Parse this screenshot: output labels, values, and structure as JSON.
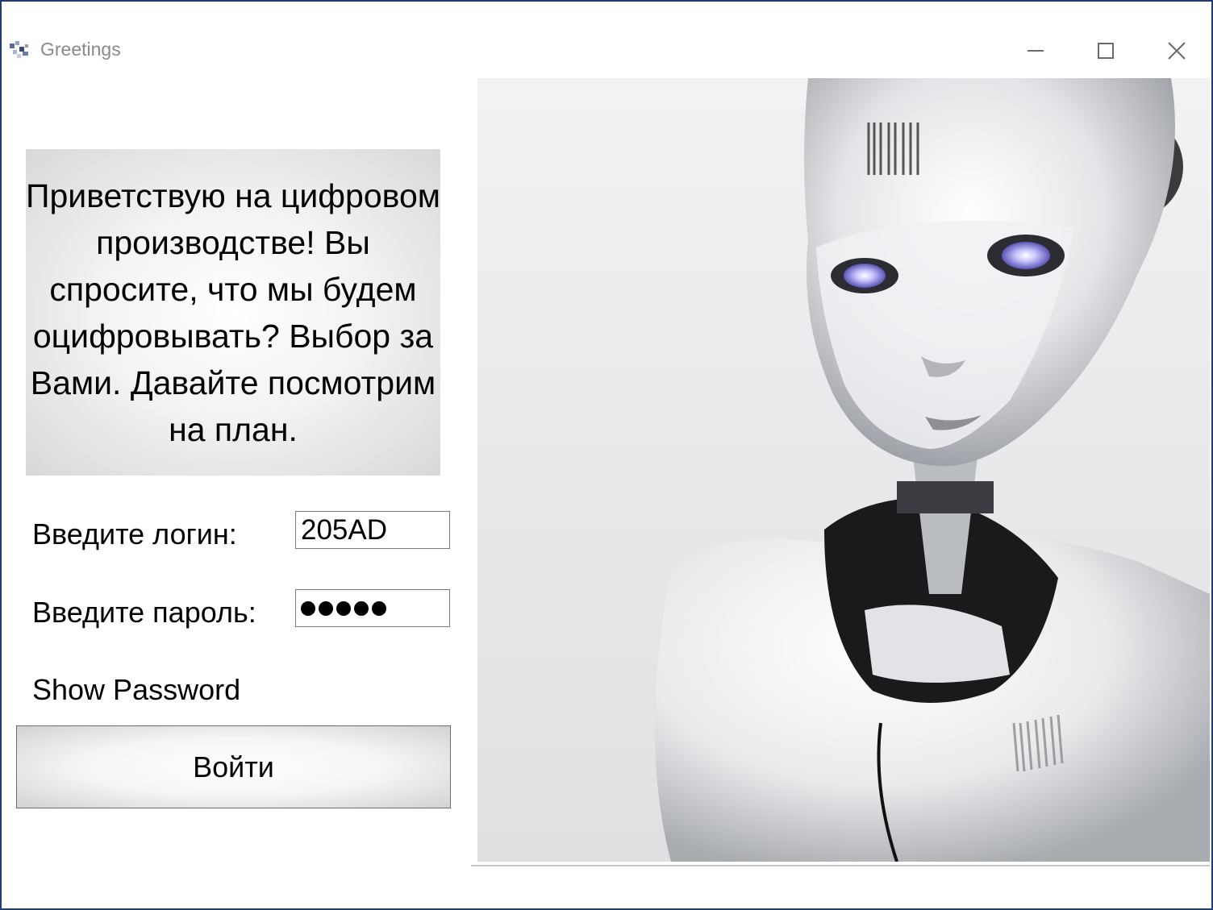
{
  "window": {
    "title": "Greetings",
    "icons": {
      "app": "app-icon",
      "minimize": "minimize-icon",
      "maximize": "maximize-icon",
      "close": "close-icon"
    }
  },
  "greeting": {
    "text": "Приветствую на цифровом производстве! Вы спросите, что мы будем оцифровывать? Выбор за Вами. Давайте посмотрим на план."
  },
  "form": {
    "login_label": "Введите логин:",
    "login_value": "205AD",
    "password_label": "Введите пароль:",
    "password_masked_length": 5,
    "show_password_label": "Show Password",
    "submit_label": "Войти"
  },
  "image": {
    "subject": "humanoid-robot-image"
  },
  "colors": {
    "window_border": "#1f3d6e",
    "title_text": "#8a8a8a",
    "field_border": "#7a7a7a"
  }
}
